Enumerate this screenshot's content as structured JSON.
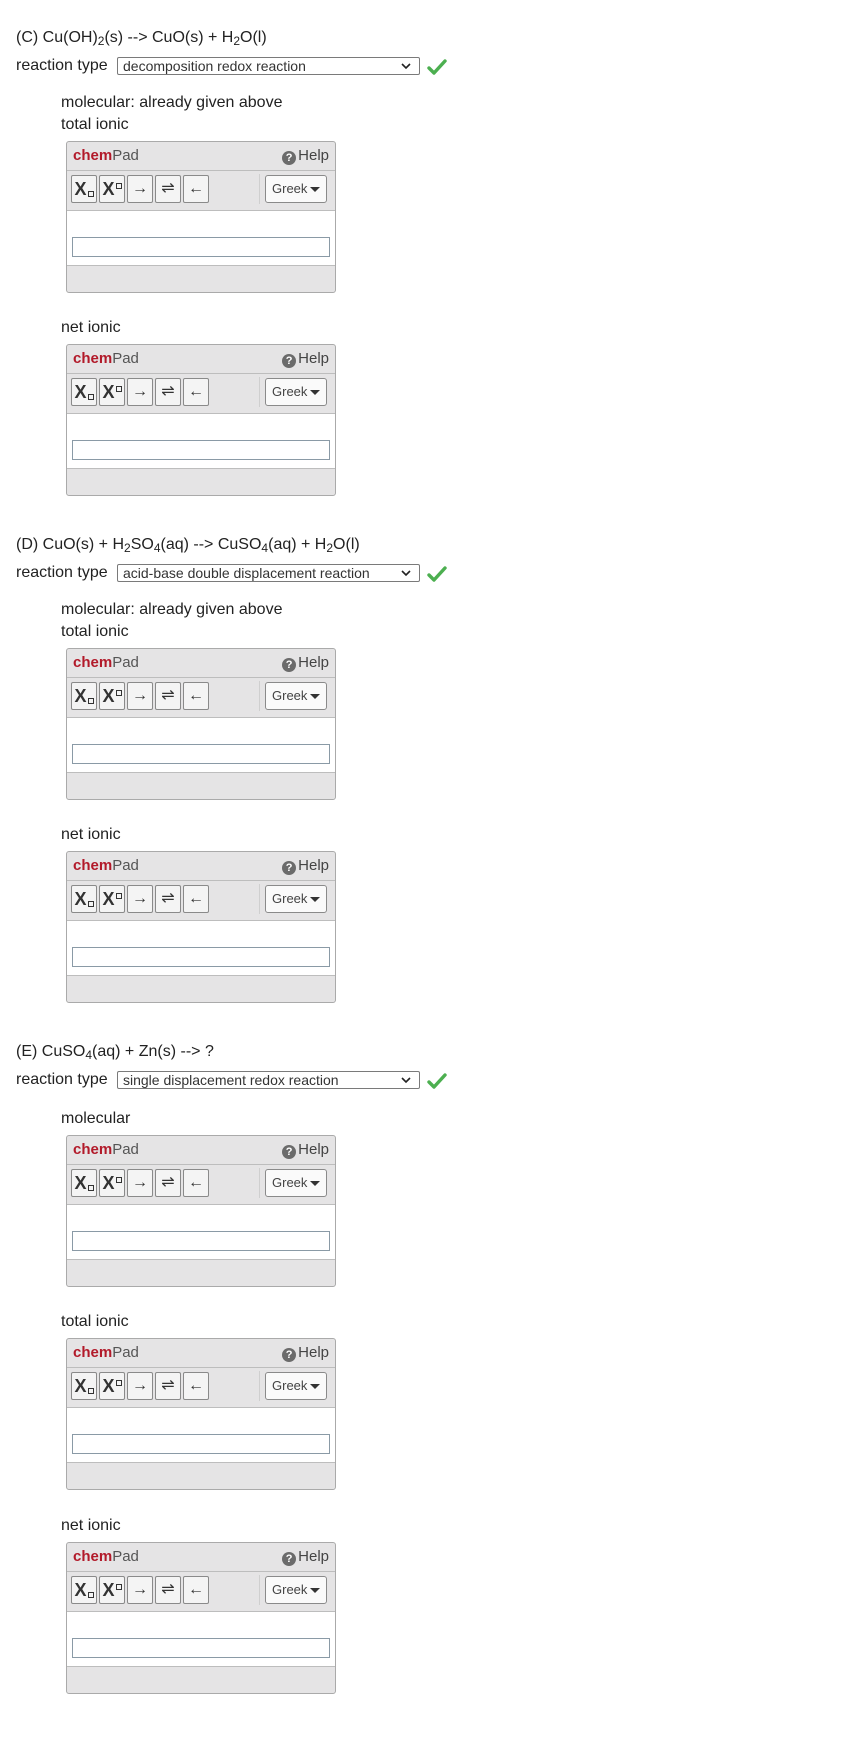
{
  "sections": [
    {
      "equation_html": "(C) Cu(OH)<sub>2</sub>(s) --> CuO(s) + H<sub>2</sub>O(l)",
      "reaction_label": "reaction type",
      "reaction_value": "decomposition redox reaction",
      "correct": true,
      "note_lines": [
        "molecular: already given above",
        "total ionic"
      ],
      "pads": [
        {
          "label": "",
          "value": ""
        },
        {
          "label": "net ionic",
          "value": ""
        }
      ]
    },
    {
      "equation_html": "(D) CuO(s) + H<sub>2</sub>SO<sub>4</sub>(aq) --> CuSO<sub>4</sub>(aq) + H<sub>2</sub>O(l)",
      "reaction_label": "reaction type",
      "reaction_value": "acid-base double displacement reaction",
      "correct": true,
      "note_lines": [
        "molecular: already given above",
        "total ionic"
      ],
      "pads": [
        {
          "label": "",
          "value": ""
        },
        {
          "label": "net ionic",
          "value": ""
        }
      ]
    },
    {
      "equation_html": "(E) CuSO<sub>4</sub>(aq) + Zn(s) --> ?",
      "reaction_label": "reaction type",
      "reaction_value": "single displacement redox reaction",
      "correct": true,
      "note_lines": [
        "molecular"
      ],
      "pads": [
        {
          "label": "",
          "value": ""
        },
        {
          "label": "total ionic",
          "value": ""
        },
        {
          "label": "net ionic",
          "value": ""
        }
      ]
    }
  ],
  "chempad": {
    "title_chem": "chem",
    "title_pad": "Pad",
    "help_label": "Help",
    "greek_label": "Greek",
    "toolbar_icons": [
      "subscript-icon",
      "superscript-icon",
      "right-arrow-icon",
      "equilibrium-arrow-icon",
      "left-arrow-icon"
    ]
  },
  "colors": {
    "chem_red": "#b21a2a",
    "check_green": "#4caf50",
    "pad_bg": "#e5e4e5"
  }
}
